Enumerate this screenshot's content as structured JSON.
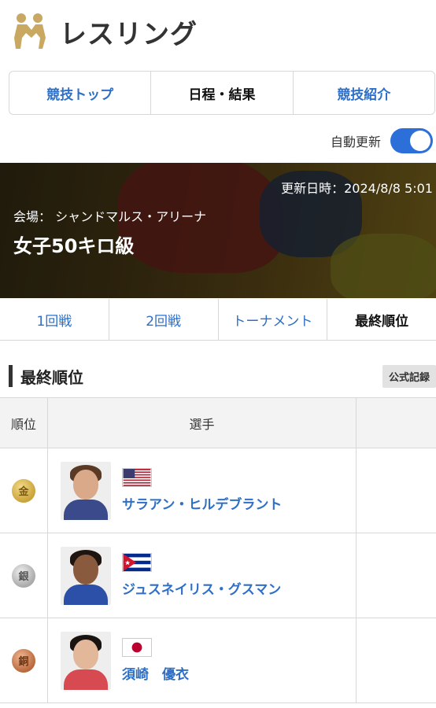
{
  "header": {
    "title": "レスリング",
    "logo_icon": "wrestling-pictogram-icon",
    "logo_color": "#c9a861"
  },
  "topnav": [
    {
      "label": "競技トップ",
      "active": false
    },
    {
      "label": "日程・結果",
      "active": true
    },
    {
      "label": "競技紹介",
      "active": false
    }
  ],
  "auto_update": {
    "label": "自動更新",
    "enabled": true,
    "accent": "#2d6fd9"
  },
  "hero": {
    "updated": "更新日時：2024/8/8 5:01",
    "venue": "会場： シャンドマルス・アリーナ",
    "event": "女子50キロ級"
  },
  "round_tabs": [
    {
      "label": "1回戦",
      "active": false
    },
    {
      "label": "2回戦",
      "active": false
    },
    {
      "label": "トーナメント",
      "active": false
    },
    {
      "label": "最終順位",
      "active": true
    }
  ],
  "section": {
    "title": "最終順位",
    "badge": "公式記録"
  },
  "table": {
    "headers": {
      "rank": "順位",
      "athlete": "選手"
    },
    "rows": [
      {
        "medal": "金",
        "medal_type": "gold",
        "name": "サラアン・ヒルデブラント",
        "flag": "usa-flag-icon"
      },
      {
        "medal": "銀",
        "medal_type": "silver",
        "name": "ジュスネイリス・グスマン",
        "flag": "cuba-flag-icon"
      },
      {
        "medal": "銅",
        "medal_type": "bronze",
        "name": "須崎　優衣",
        "flag": "japan-flag-icon"
      }
    ]
  },
  "colors": {
    "link": "#2f6fc5",
    "border": "#d8d8d8"
  }
}
